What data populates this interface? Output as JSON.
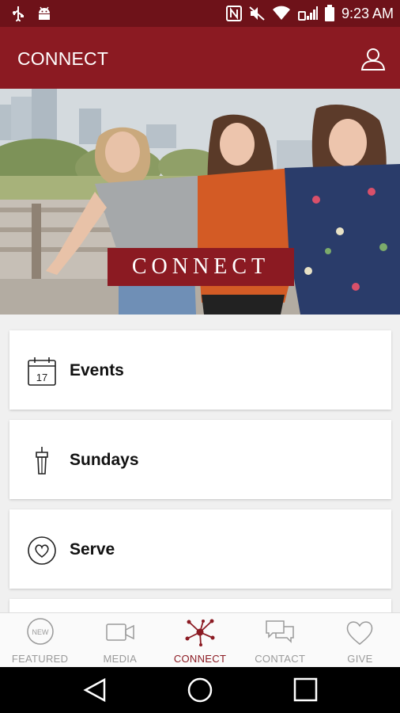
{
  "status_bar": {
    "time": "9:23 AM",
    "icons": [
      "usb-icon",
      "android-icon",
      "nfc-icon",
      "mute-icon",
      "wifi-icon",
      "signal-icon",
      "battery-icon"
    ]
  },
  "app_bar": {
    "title": "CONNECT",
    "profile_icon": "user-icon"
  },
  "hero": {
    "banner_text": "CONNECT"
  },
  "menu": {
    "items": [
      {
        "label": "Events",
        "icon": "calendar-icon",
        "icon_text": "17"
      },
      {
        "label": "Sundays",
        "icon": "podium-icon"
      },
      {
        "label": "Serve",
        "icon": "heart-circle-icon"
      }
    ]
  },
  "bottom_nav": {
    "active": "CONNECT",
    "items": [
      {
        "label": "FEATURED",
        "icon": "new-badge-icon",
        "icon_text": "NEW"
      },
      {
        "label": "MEDIA",
        "icon": "video-camera-icon"
      },
      {
        "label": "CONNECT",
        "icon": "network-icon"
      },
      {
        "label": "CONTACT",
        "icon": "chat-bubbles-icon"
      },
      {
        "label": "GIVE",
        "icon": "heart-icon"
      }
    ]
  },
  "colors": {
    "primary": "#8b1a22",
    "status_bar": "#6e1219",
    "inactive": "#9a9a9a"
  }
}
